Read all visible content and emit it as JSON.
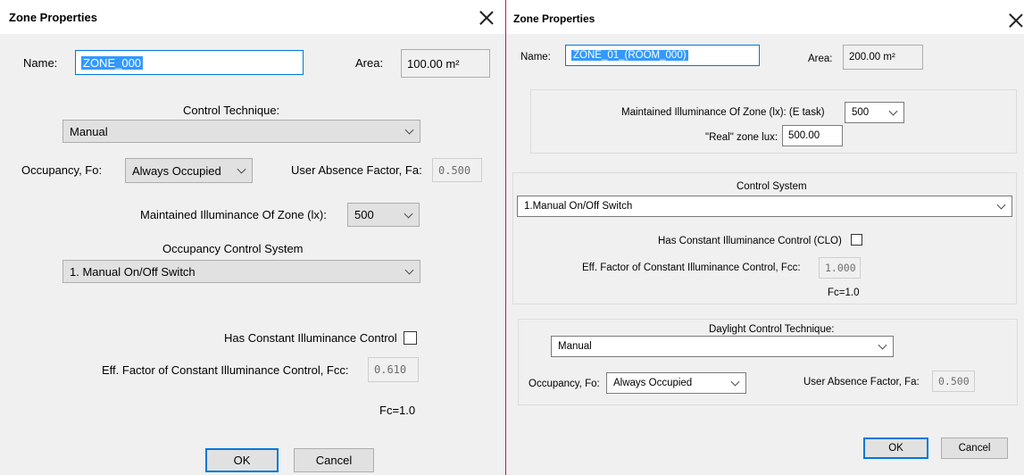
{
  "left_dialog": {
    "title": "Zone Properties",
    "name_label": "Name:",
    "name_value": "ZONE_000",
    "area_label": "Area:",
    "area_value": "100.00 m²",
    "control_technique_label": "Control Technique:",
    "control_technique_value": "Manual",
    "occupancy_label": "Occupancy, Fo:",
    "occupancy_value": "Always Occupied",
    "absence_label": "User Absence Factor, Fa:",
    "absence_value": "0.500",
    "illuminance_label": "Maintained Illuminance Of Zone (lx):",
    "illuminance_value": "500",
    "occupancy_control_label": "Occupancy Control System",
    "occupancy_control_value": "1. Manual On/Off Switch",
    "clo_label": "Has Constant Illuminance Control",
    "clo_checked": false,
    "fcc_label": "Eff. Factor of Constant Illuminance Control, Fcc:",
    "fcc_value": "0.610",
    "fc_text": "Fc=1.0",
    "ok_label": "OK",
    "cancel_label": "Cancel"
  },
  "right_dialog": {
    "title": "Zone Properties",
    "name_label": "Name:",
    "name_value": "ZONE_01_(ROOM_000)",
    "area_label": "Area:",
    "area_value": "200.00 m²",
    "illuminance_label": "Maintained Illuminance Of Zone (lx): (E task)",
    "illuminance_value": "500",
    "real_lux_label": "\"Real\" zone lux:",
    "real_lux_value": "500.00",
    "control_system_label": "Control System",
    "control_system_value": "1.Manual On/Off Switch",
    "clo_label": "Has Constant Illuminance Control (CLO)",
    "clo_checked": false,
    "fcc_label": "Eff. Factor of Constant Illuminance Control, Fcc:",
    "fcc_value": "1.000",
    "fc_text": "Fc=1.0",
    "daylight_label": "Daylight Control Technique:",
    "daylight_value": "Manual",
    "occupancy_label": "Occupancy, Fo:",
    "occupancy_value": "Always Occupied",
    "absence_label": "User Absence Factor, Fa:",
    "absence_value": "0.500",
    "ok_label": "OK",
    "cancel_label": "Cancel"
  },
  "colors": {
    "accent": "#0078d7",
    "selection": "#3399ff",
    "divider": "#c2185b"
  }
}
